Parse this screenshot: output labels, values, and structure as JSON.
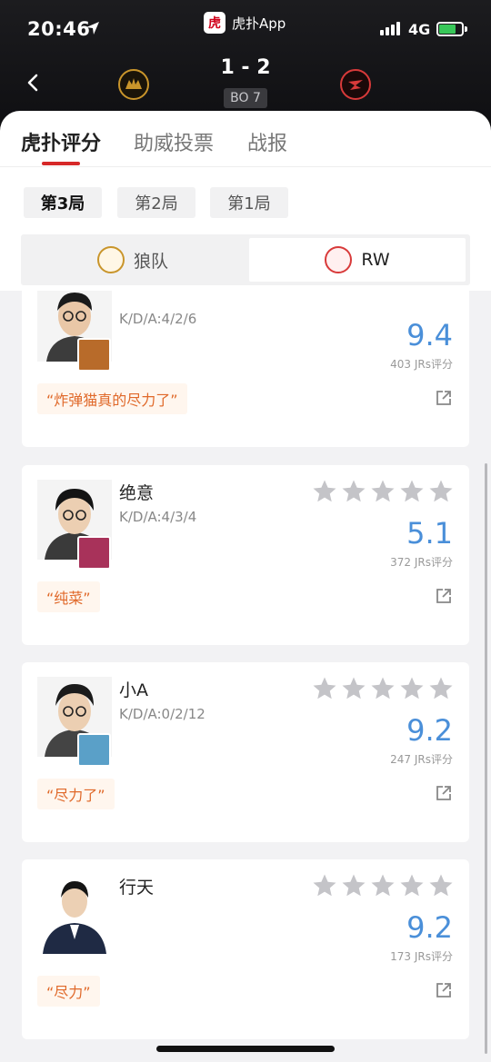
{
  "status": {
    "time": "20:46",
    "network": "4G",
    "app_name": "虎扑App",
    "app_logo_char": "虎"
  },
  "match": {
    "score": "1 - 2",
    "bo": "BO 7",
    "team1_logo": "wolves-logo",
    "team2_logo": "rw-logo"
  },
  "tabs": [
    {
      "label": "虎扑评分",
      "active": true
    },
    {
      "label": "助威投票",
      "active": false
    },
    {
      "label": "战报",
      "active": false
    }
  ],
  "games": [
    {
      "label": "第3局",
      "active": true
    },
    {
      "label": "第2局",
      "active": false
    },
    {
      "label": "第1局",
      "active": false
    }
  ],
  "team_toggle": [
    {
      "label": "狼队",
      "selected": false
    },
    {
      "label": "RW",
      "selected": true
    }
  ],
  "players": [
    {
      "name": "",
      "kda": "K/D/A:4/2/6",
      "rating": "9.4",
      "votes": "403 JRs评分",
      "quote": "“炸弹猫真的尽力了”",
      "hero_color": "#b86b2a"
    },
    {
      "name": "绝意",
      "kda": "K/D/A:4/3/4",
      "rating": "5.1",
      "votes": "372 JRs评分",
      "quote": "“纯菜”",
      "hero_color": "#a8325a"
    },
    {
      "name": "小A",
      "kda": "K/D/A:0/2/12",
      "rating": "9.2",
      "votes": "247 JRs评分",
      "quote": "“尽力了”",
      "hero_color": "#5aa0c8"
    },
    {
      "name": "行天",
      "kda": "",
      "rating": "9.2",
      "votes": "173 JRs评分",
      "quote": "“尽力”",
      "hero_color": ""
    }
  ],
  "colors": {
    "accent_red": "#d62828",
    "rating_blue": "#4a8fd9",
    "quote_orange": "#e0692a",
    "star_gray": "#c4c4c8"
  }
}
